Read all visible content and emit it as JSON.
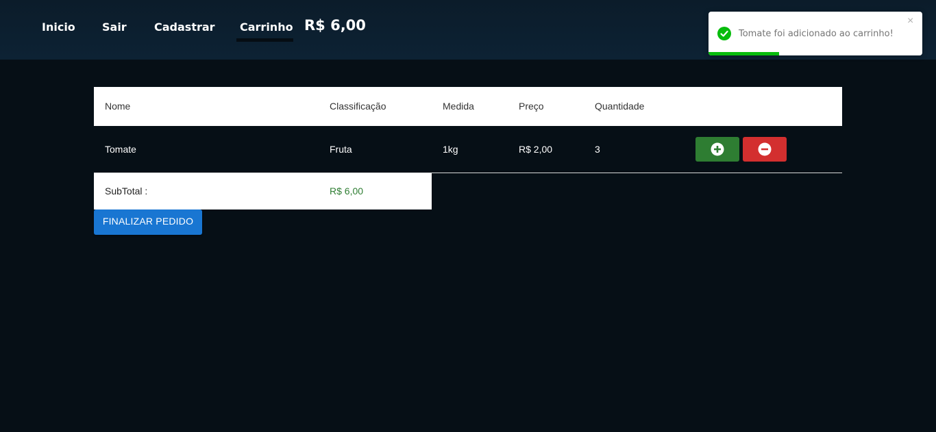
{
  "nav": {
    "items": [
      {
        "label": "Inicio"
      },
      {
        "label": "Sair"
      },
      {
        "label": "Cadastrar"
      },
      {
        "label": "Carrinho",
        "active": true
      }
    ],
    "cart_total": "R$ 6,00"
  },
  "toast": {
    "message": "Tomate foi adicionado ao carrinho!",
    "close_symbol": "×",
    "type": "success",
    "progress": 0.33,
    "icon": "check-circle-icon",
    "color": "#07bc0c"
  },
  "table": {
    "headers": [
      "Nome",
      "Classificação",
      "Medida",
      "Preço",
      "Quantidade"
    ],
    "rows": [
      {
        "nome": "Tomate",
        "classificacao": "Fruta",
        "medida": "1kg",
        "preco": "R$ 2,00",
        "quantidade": "3"
      }
    ]
  },
  "actions": {
    "add_icon": "plus-circle-icon",
    "remove_icon": "minus-circle-icon",
    "add_color": "#2e7d32",
    "remove_color": "#d32f2f"
  },
  "subtotal": {
    "label": "SubTotal :",
    "value": "R$ 6,00"
  },
  "checkout": {
    "label": "FINALIZAR PEDIDO",
    "color": "#1976d2"
  }
}
